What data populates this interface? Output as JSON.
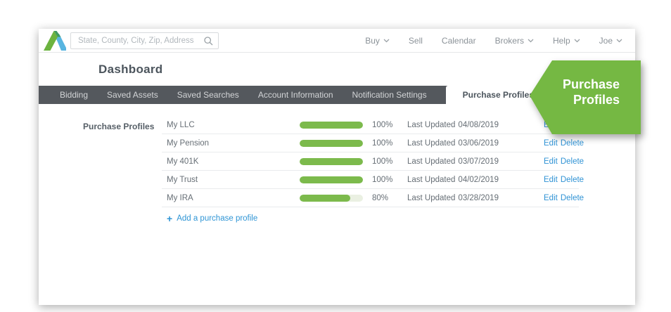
{
  "topnav": {
    "search_placeholder": "State, County, City, Zip, Address",
    "items": [
      {
        "label": "Buy",
        "has_dropdown": true
      },
      {
        "label": "Sell",
        "has_dropdown": false
      },
      {
        "label": "Calendar",
        "has_dropdown": false
      },
      {
        "label": "Brokers",
        "has_dropdown": true
      },
      {
        "label": "Help",
        "has_dropdown": true
      },
      {
        "label": "Joe",
        "has_dropdown": true
      }
    ]
  },
  "page_title": "Dashboard",
  "tabs": [
    {
      "label": "Bidding",
      "active": false
    },
    {
      "label": "Saved Assets",
      "active": false
    },
    {
      "label": "Saved Searches",
      "active": false
    },
    {
      "label": "Account Information",
      "active": false
    },
    {
      "label": "Notification Settings",
      "active": false
    },
    {
      "label": "Purchase Profiles",
      "active": true
    }
  ],
  "callout": {
    "lines": [
      "Purchase",
      "Profiles"
    ],
    "color": "#75b843"
  },
  "section_label": "Purchase Profiles",
  "labels": {
    "last_updated_prefix": "Last Updated",
    "edit": "Edit",
    "delete": "Delete",
    "plus_icon": "+",
    "add_link": "Add a purchase profile"
  },
  "profiles": [
    {
      "name": "My LLC",
      "percent": 100,
      "percent_label": "100%",
      "last_updated": "04/08/2019"
    },
    {
      "name": "My Pension",
      "percent": 100,
      "percent_label": "100%",
      "last_updated": "03/06/2019"
    },
    {
      "name": "My 401K",
      "percent": 100,
      "percent_label": "100%",
      "last_updated": "03/07/2019"
    },
    {
      "name": "My Trust",
      "percent": 100,
      "percent_label": "100%",
      "last_updated": "04/02/2019"
    },
    {
      "name": "My IRA",
      "percent": 80,
      "percent_label": "80%",
      "last_updated": "03/28/2019"
    }
  ],
  "colors": {
    "accent_green": "#75b843",
    "bar_green": "#7cba4c",
    "bar_track": "#eaf0e2",
    "link_blue": "#3093d5",
    "tabbar_gray": "#54585d",
    "logo_green": "#6cb33f",
    "logo_blue": "#58b5e0"
  }
}
